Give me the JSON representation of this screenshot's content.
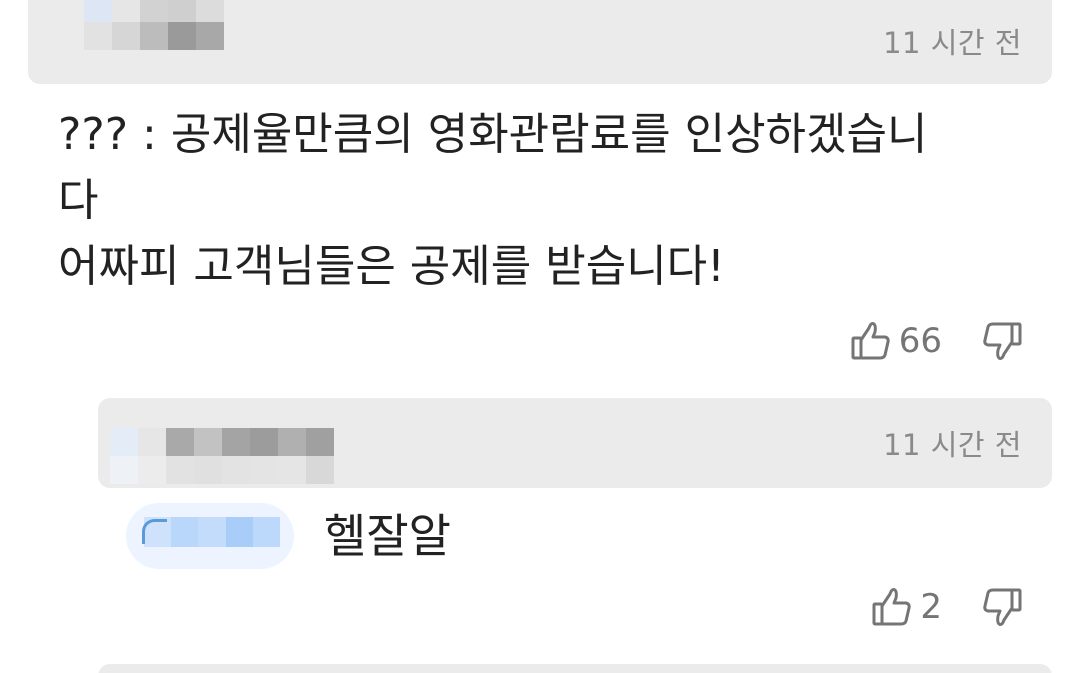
{
  "comment": {
    "timestamp": "11 시간 전",
    "lines": [
      "??? : 공제율만큼의 영화관람료를 인상하겠습니",
      "다",
      "어짜피 고객님들은 공제를 받습니다!"
    ],
    "like_count": "66",
    "like_icon": "thumbs-up-icon",
    "dislike_icon": "thumbs-down-icon"
  },
  "reply": {
    "timestamp": "11 시간 전",
    "text": "헬잘알",
    "like_count": "2",
    "like_icon": "thumbs-up-icon",
    "dislike_icon": "thumbs-down-icon"
  },
  "colors": {
    "meta_bar": "#ebebeb",
    "timestamp": "#8a8a8a",
    "text": "#222222",
    "icon": "#757575",
    "mention_chip": "#edf4ff"
  }
}
